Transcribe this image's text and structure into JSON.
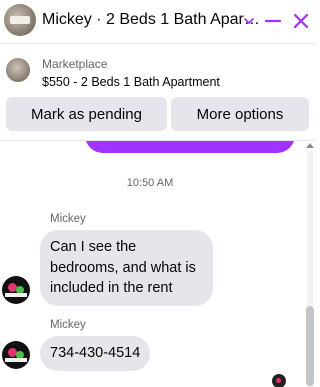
{
  "header": {
    "title": "Mickey · 2 Beds 1 Bath Apartment",
    "icons": [
      "chevron-down-icon",
      "minimize-icon",
      "close-icon"
    ],
    "accent_color": "#a033ff"
  },
  "listing": {
    "label": "Marketplace",
    "title": "$550 - 2 Beds 1 Bath Apartment",
    "buttons": {
      "mark_pending": "Mark as pending",
      "more_options": "More options"
    }
  },
  "chat": {
    "timestamp": "10:50 AM",
    "messages": [
      {
        "sender": "Mickey",
        "text": "Can I see the bedrooms, and what is included in the rent"
      },
      {
        "sender": "Mickey",
        "text": "734-430-4514"
      }
    ],
    "bubble_color": "#e4e6eb"
  }
}
